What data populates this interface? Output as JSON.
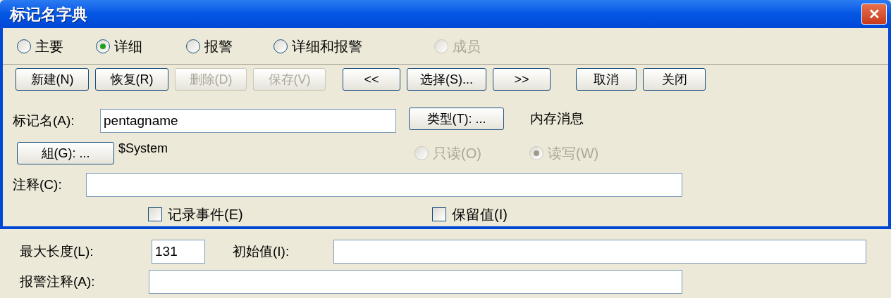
{
  "window": {
    "title": "标记名字典",
    "close_label": "✕"
  },
  "view_options": [
    {
      "label": "主要",
      "selected": false,
      "disabled": false
    },
    {
      "label": "详细",
      "selected": true,
      "disabled": false
    },
    {
      "label": "报警",
      "selected": false,
      "disabled": false
    },
    {
      "label": "详细和报警",
      "selected": false,
      "disabled": false
    },
    {
      "label": "成员",
      "selected": false,
      "disabled": true
    }
  ],
  "toolbar_groups": [
    [
      {
        "label": "新建(N)",
        "disabled": false
      },
      {
        "label": "恢复(R)",
        "disabled": false
      },
      {
        "label": "删除(D)",
        "disabled": true
      },
      {
        "label": "保存(V)",
        "disabled": true
      }
    ],
    [
      {
        "label": "<<",
        "disabled": false
      },
      {
        "label": "选择(S)...",
        "disabled": false
      },
      {
        "label": ">>",
        "disabled": false
      }
    ],
    [
      {
        "label": "取消",
        "disabled": false
      },
      {
        "label": "关闭",
        "disabled": false
      }
    ]
  ],
  "tag_name": {
    "label": "标记名(A):",
    "value": "pentagname"
  },
  "type": {
    "button": "类型(T): ...",
    "value": "内存消息"
  },
  "group": {
    "button": "組(G): ...",
    "value": "$System"
  },
  "access": [
    {
      "label": "只读(O)",
      "selected": false,
      "disabled": true
    },
    {
      "label": "读写(W)",
      "selected": true,
      "disabled": true
    }
  ],
  "comment": {
    "label": "注释(C):"
  },
  "options": [
    {
      "label": "记录事件(E)",
      "checked": false
    },
    {
      "label": "保留值(I)",
      "checked": false
    }
  ],
  "details": {
    "max_length": {
      "label": "最大长度(L):",
      "value": "131"
    },
    "initial_value": {
      "label": "初始值(I):"
    },
    "alarm_comment": {
      "label": "报警注释(A):"
    }
  }
}
